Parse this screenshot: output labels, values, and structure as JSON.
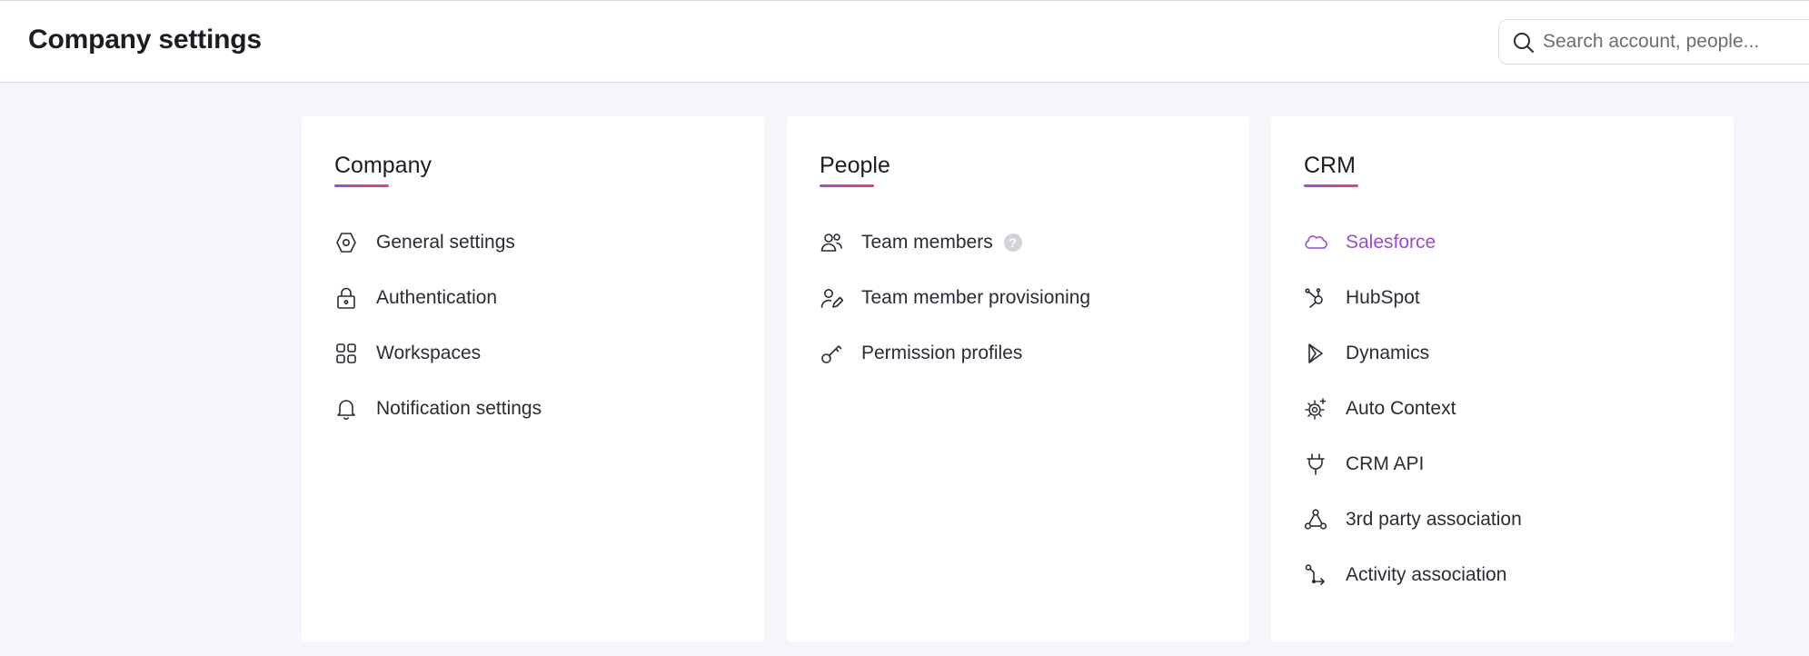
{
  "header": {
    "title": "Company settings",
    "search_placeholder": "Search account, people..."
  },
  "cards": [
    {
      "title": "Company",
      "items": [
        {
          "label": "General settings",
          "icon": "hexagon-icon"
        },
        {
          "label": "Authentication",
          "icon": "lock-icon"
        },
        {
          "label": "Workspaces",
          "icon": "grid-icon"
        },
        {
          "label": "Notification settings",
          "icon": "bell-icon"
        }
      ]
    },
    {
      "title": "People",
      "items": [
        {
          "label": "Team members",
          "icon": "users-icon",
          "help_badge": "?"
        },
        {
          "label": "Team member provisioning",
          "icon": "user-edit-icon"
        },
        {
          "label": "Permission profiles",
          "icon": "key-icon"
        }
      ]
    },
    {
      "title": "CRM",
      "items": [
        {
          "label": "Salesforce",
          "icon": "cloud-icon",
          "active": true
        },
        {
          "label": "HubSpot",
          "icon": "hubspot-icon"
        },
        {
          "label": "Dynamics",
          "icon": "dynamics-icon"
        },
        {
          "label": "Auto Context",
          "icon": "gear-sparkle-icon"
        },
        {
          "label": "CRM API",
          "icon": "plug-icon"
        },
        {
          "label": "3rd party association",
          "icon": "network-icon"
        },
        {
          "label": "Activity association",
          "icon": "branch-icon"
        }
      ]
    }
  ],
  "colors": {
    "accent": "#9b4dc9",
    "underline_start": "#a14ad8",
    "underline_end": "#e83d8a",
    "background": "#f5f6fa"
  }
}
